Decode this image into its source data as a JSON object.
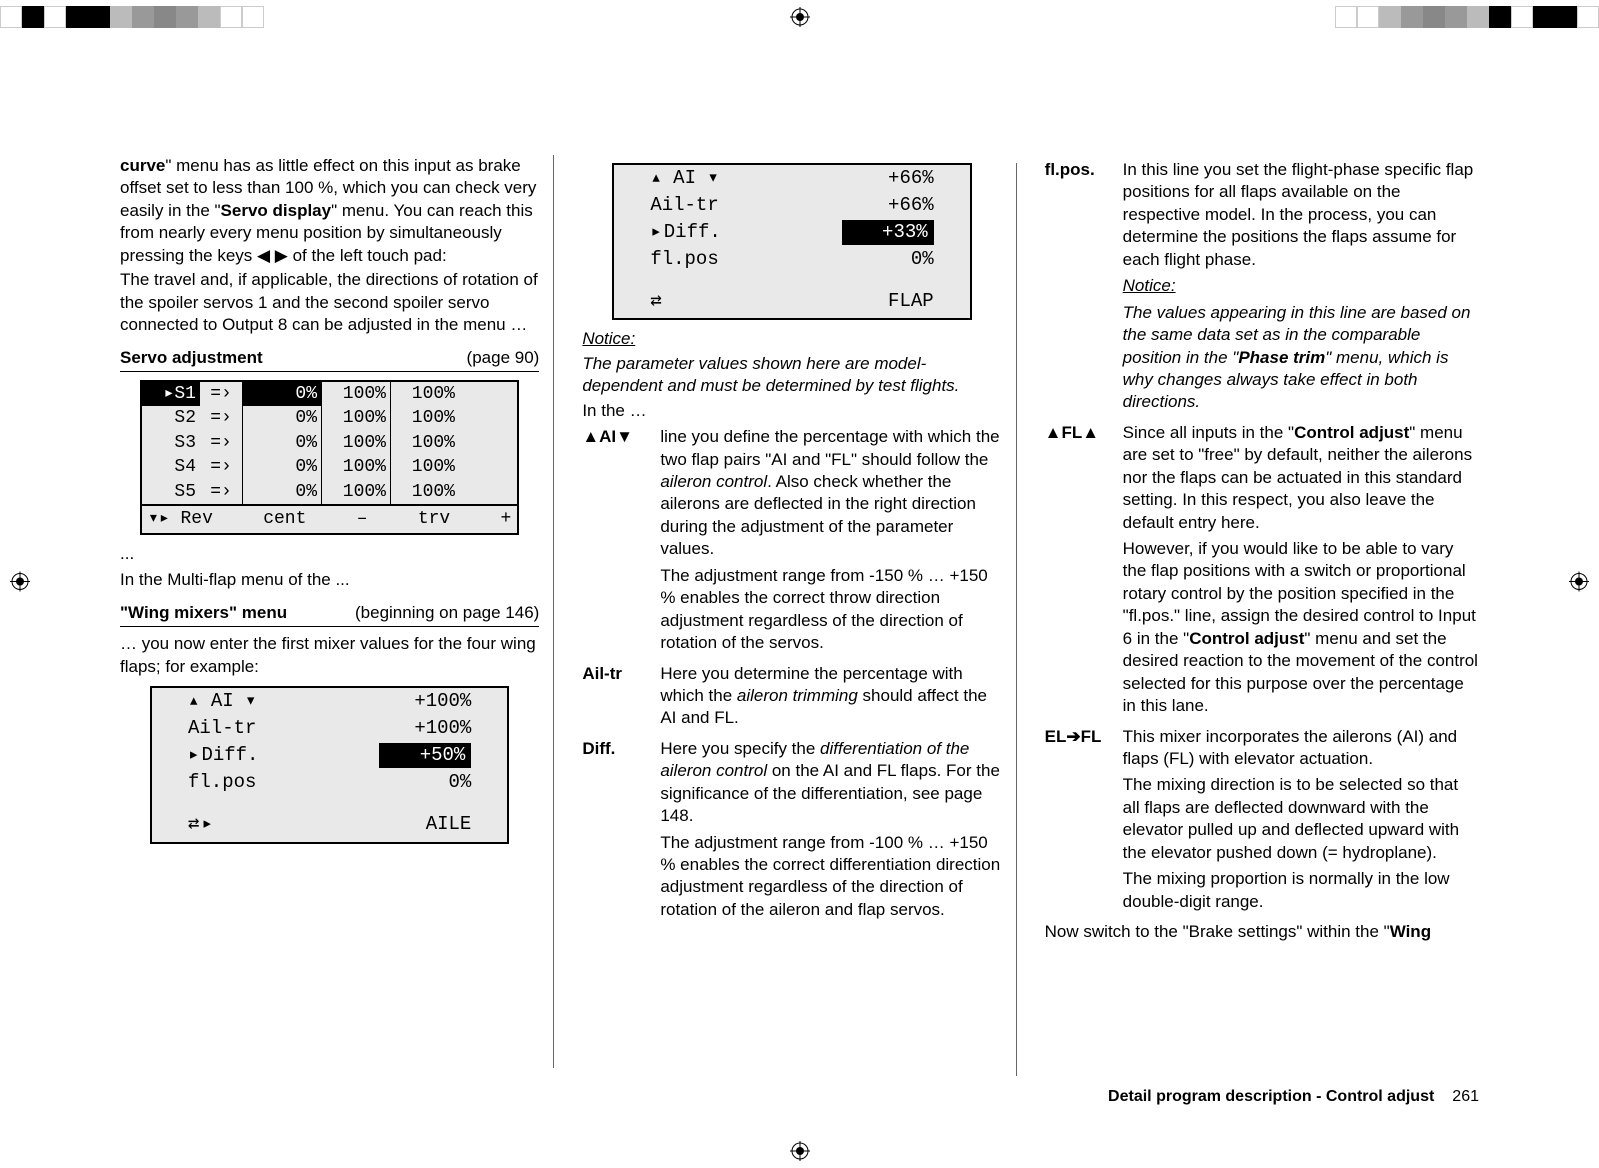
{
  "col1": {
    "para1_a": "curve",
    "para1_b": "\" menu has as little effect on this input as brake offset set to less than 100 %, which you can check very easily in the \"",
    "para1_c": "Servo display",
    "para1_d": "\" menu. You can reach this from nearly every menu position by simultaneously pressing the keys ◀ ▶ of the left touch pad:",
    "para2": "The travel and, if applicable, the directions of rotation of the spoiler servos 1 and the second spoiler servo connected to Output 8 can be adjusted in the menu …",
    "heading1": "Servo adjustment",
    "heading1_page": "(page 90)",
    "table": {
      "rows": [
        {
          "s": "S1",
          "a": "=›",
          "b": "0%",
          "c": "100%",
          "d": "100%",
          "sel": true
        },
        {
          "s": "S2",
          "a": "=›",
          "b": "0%",
          "c": "100%",
          "d": "100%",
          "sel": false
        },
        {
          "s": "S3",
          "a": "=›",
          "b": "0%",
          "c": "100%",
          "d": "100%",
          "sel": false
        },
        {
          "s": "S4",
          "a": "=›",
          "b": "0%",
          "c": "100%",
          "d": "100%",
          "sel": false
        },
        {
          "s": "S5",
          "a": "=›",
          "b": "0%",
          "c": "100%",
          "d": "100%",
          "sel": false
        }
      ],
      "footer": [
        "▾▸ Rev",
        "cent",
        "–",
        "trv",
        "+"
      ]
    },
    "ellipsis": "...",
    "para3": "In the Multi-flap menu of the ...",
    "heading2": "\"Wing mixers\" menu",
    "heading2_page": "(beginning on page 146)",
    "para4": "… you now enter the first mixer values for the four wing flaps; for example:",
    "menubox": {
      "rows": [
        {
          "lab": "▴ AI ▾",
          "val": "+100%",
          "sel": false
        },
        {
          "lab": "Ail-tr",
          "val": "+100%",
          "sel": false
        },
        {
          "lab": "Diff.",
          "val": "+50%",
          "sel": true
        },
        {
          "lab": "fl.pos",
          "val": "0%",
          "sel": false
        }
      ],
      "foot_left": "⇄▸",
      "foot_right": "AILE"
    }
  },
  "col2": {
    "menubox": {
      "rows": [
        {
          "lab": "▴ AI ▾",
          "val": "+66%",
          "sel": false
        },
        {
          "lab": "Ail-tr",
          "val": "+66%",
          "sel": false
        },
        {
          "lab": "Diff.",
          "val": "+33%",
          "sel": true
        },
        {
          "lab": "fl.pos",
          "val": "0%",
          "sel": false
        }
      ],
      "foot_left": "⇄",
      "foot_right": "FLAP"
    },
    "notice_label": "Notice:",
    "notice_text": "The parameter values shown here are model-dependent and must be determined by test flights.",
    "in_the": "In the …",
    "defs": [
      {
        "term": "▲AI▼",
        "paras": [
          {
            "plain": "line you define the percentage with which the two flap pairs \"AI and \"FL\" should follow the ",
            "em": "aileron control",
            "after": ". Also check whether the ailerons are deflected in the right direction during the adjustment of the parameter values."
          },
          {
            "plain": "The adjustment range from -150 % … +150 % enables the correct throw direction adjustment regardless of the direction of rotation of the servos."
          }
        ]
      },
      {
        "term": "Ail-tr",
        "paras": [
          {
            "plain": "Here you determine the percentage with which the ",
            "em": "aileron trimming",
            "after": " should affect the AI and FL."
          }
        ]
      },
      {
        "term": "Diff.",
        "paras": [
          {
            "plain": "Here you specify the ",
            "em": "differentiation of the aileron control",
            "after": " on the AI and FL flaps. For the significance of the differentiation, see page 148."
          },
          {
            "plain": "The adjustment range from -100 % … +150 % enables the correct differentiation direction adjustment regardless of the direction of rotation of the aileron and flap servos."
          }
        ]
      }
    ]
  },
  "col3": {
    "defs": [
      {
        "term": "fl.pos.",
        "paras": [
          {
            "plain": "In this line you set the flight-phase specific flap positions for all flaps available on the respective model. In the process, you can determine the positions the flaps assume for each flight phase."
          }
        ],
        "notice_label": "Notice:",
        "notice_text_a": "The values appearing in this line are based on the same data set as in the comparable position in the \"",
        "notice_bold": "Phase trim",
        "notice_text_b": "\" menu, which is why changes always take effect in both directions."
      },
      {
        "term": "▲FL▲",
        "paras": [
          {
            "plain": "Since all inputs in the \"",
            "b": "Control adjust",
            "after": "\" menu are set to \"free\" by default, neither the ailerons nor the flaps can be actuated in this standard setting. In this respect, you also leave the default entry here."
          },
          {
            "plain": "However, if you would like to be able to vary the flap positions with a switch or proportional rotary control by the position specified in the \"fl.pos.\" line, assign the desired control to Input 6 in the \"",
            "b": "Control adjust",
            "after": "\" menu and set the desired reaction to the movement of the control selected for this purpose over the percentage in this lane."
          }
        ]
      },
      {
        "term": "EL➔FL",
        "paras": [
          {
            "plain": "This mixer incorporates the ailerons (AI) and flaps (FL) with elevator actuation."
          },
          {
            "plain": "The mixing direction is to be selected so that all flaps are deflected downward with the elevator pulled up and deflected upward with the elevator pushed down (= hydroplane)."
          },
          {
            "plain": "The mixing proportion is normally in the low double-digit range."
          }
        ]
      }
    ],
    "closing_a": "Now switch to the \"Brake settings\" within the \"",
    "closing_b": "Wing"
  },
  "footer": {
    "title": "Detail program description - Control adjust",
    "page": "261"
  }
}
